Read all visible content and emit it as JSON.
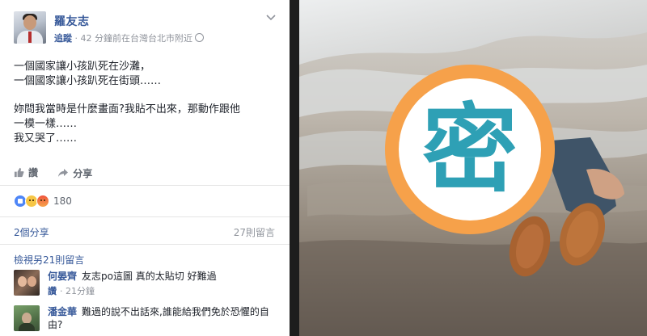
{
  "post": {
    "author": "羅友志",
    "follow_label": "追蹤",
    "timestamp": "42 分鐘前在台灣台北市附近",
    "separator": " · ",
    "lines": [
      "一個國家讓小孩趴死在沙灘，",
      "一個國家讓小孩趴死在街頭……",
      "",
      "妳問我當時是什麼畫面?我貼不出來，那動作跟他",
      "一模一樣……",
      "我又哭了……"
    ],
    "like_label": "讚",
    "share_label": "分享",
    "reaction_count": "180",
    "shares_text": "2個分享",
    "comments_count_text": "27則留言",
    "view_more_text": "檢視另21則留言"
  },
  "comments": [
    {
      "name": "何晏齊",
      "text": "友志po這圖 真的太貼切 好難過",
      "like_label": "讚",
      "time": "21分鐘"
    },
    {
      "name": "潘金華",
      "text": "難過的說不出話來,誰能給我們免於恐懼的自由?"
    }
  ],
  "overlay": {
    "badge_char": "密",
    "ring_color": "#f6a14a",
    "char_color": "#2ea0b5"
  },
  "icons": [
    "chevron-down-icon",
    "globe-icon",
    "thumbs-up-icon",
    "share-arrow-icon",
    "like-reaction-icon",
    "sad-reaction-icon",
    "angry-reaction-icon"
  ]
}
